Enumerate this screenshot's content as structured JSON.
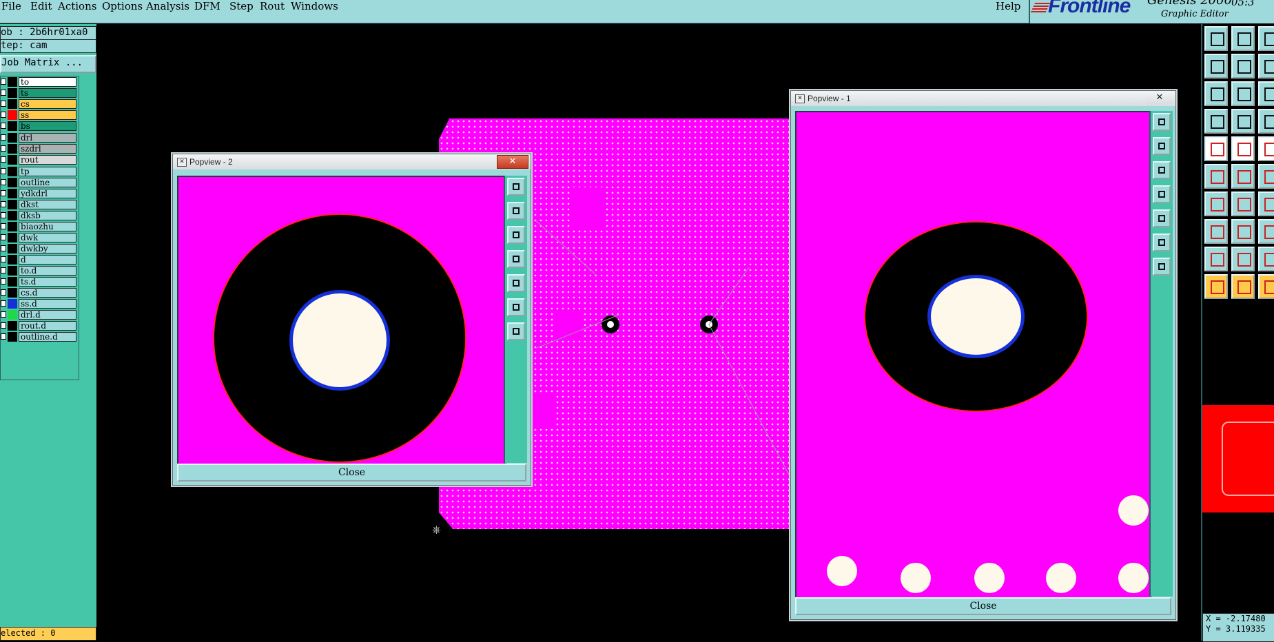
{
  "menubar": {
    "items": [
      "File",
      "Edit",
      "Actions",
      "Options",
      "Analysis",
      "DFM",
      "Step",
      "Rout",
      "Windows"
    ],
    "help": "Help"
  },
  "brand": {
    "logo": "Frontline",
    "product": "Genesis 2000",
    "subtitle": "Graphic Editor",
    "clock": "05:3"
  },
  "left": {
    "job": "ob : 2b6hr01xa0",
    "step": "tep: cam",
    "job_matrix": "Job Matrix ...",
    "selected": "elected : 0",
    "layers": [
      {
        "name": "to",
        "color": "#ffffff",
        "swatch": "#000000"
      },
      {
        "name": "ts",
        "color": "#1d9b76",
        "swatch": "#000000"
      },
      {
        "name": "cs",
        "color": "#ffc94a",
        "swatch": "#000000"
      },
      {
        "name": "ss",
        "color": "#ffc94a",
        "swatch": "#ff0000"
      },
      {
        "name": "bs",
        "color": "#1d9b76",
        "swatch": "#000000"
      },
      {
        "name": "drl",
        "color": "#a9b3b4",
        "swatch": "#000000"
      },
      {
        "name": "szdrl",
        "color": "#a9b3b4",
        "swatch": "#000000"
      },
      {
        "name": "rout",
        "color": "#d9d9d9",
        "swatch": "#000000"
      },
      {
        "name": "tp",
        "color": "#9ed9dc",
        "swatch": "#000000"
      },
      {
        "name": "outline",
        "color": "#9ed9dc",
        "swatch": "#000000"
      },
      {
        "name": "ydkdrl",
        "color": "#9ed9dc",
        "swatch": "#000000"
      },
      {
        "name": "dkst",
        "color": "#9ed9dc",
        "swatch": "#000000"
      },
      {
        "name": "dksb",
        "color": "#9ed9dc",
        "swatch": "#000000"
      },
      {
        "name": "biaozhu",
        "color": "#9ed9dc",
        "swatch": "#000000"
      },
      {
        "name": "dwk",
        "color": "#9ed9dc",
        "swatch": "#000000"
      },
      {
        "name": "dwkby",
        "color": "#9ed9dc",
        "swatch": "#000000"
      },
      {
        "name": "d",
        "color": "#9ed9dc",
        "swatch": "#000000"
      },
      {
        "name": "to.d",
        "color": "#9ed9dc",
        "swatch": "#000000"
      },
      {
        "name": "ts.d",
        "color": "#9ed9dc",
        "swatch": "#000000"
      },
      {
        "name": "cs.d",
        "color": "#9ed9dc",
        "swatch": "#000000"
      },
      {
        "name": "ss.d",
        "color": "#9ed9dc",
        "swatch": "#1530d8"
      },
      {
        "name": "drl.d",
        "color": "#9ed9dc",
        "swatch": "#1fd84a"
      },
      {
        "name": "rout.d",
        "color": "#9ed9dc",
        "swatch": "#000000"
      },
      {
        "name": "outline.d",
        "color": "#9ed9dc",
        "swatch": "#000000"
      }
    ]
  },
  "popup2": {
    "title": "Popview - 2",
    "close_x": "✕",
    "close_label": "Close"
  },
  "popup1": {
    "title": "Popview - 1",
    "close_x": "✕",
    "close_label": "Close"
  },
  "coords": {
    "x": "X = -2.17480",
    "y": "Y = 3.119335"
  },
  "colors": {
    "board": "#ff00ff",
    "ui_bg": "#9ed9dc",
    "panel": "#45c6a9",
    "hole_ring": "#1530d8",
    "pad_edge": "#ff2020"
  }
}
